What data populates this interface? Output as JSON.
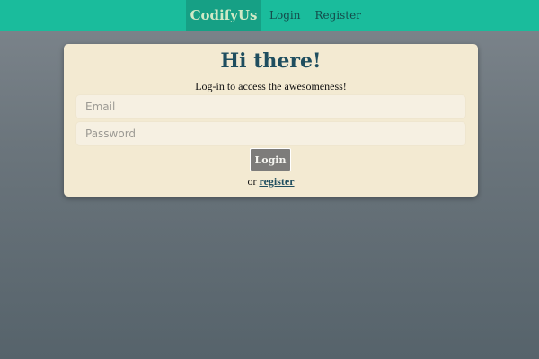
{
  "navbar": {
    "brand": "CodifyUs",
    "links": [
      "Login",
      "Register"
    ]
  },
  "login_card": {
    "title": "Hi there!",
    "subtitle": "Log-in to access the awesomeness!",
    "email_placeholder": "Email",
    "password_placeholder": "Password",
    "login_button": "Login",
    "register_prefix": "or",
    "register_link": "register"
  },
  "colors": {
    "navbar": "#1abc9c",
    "brand_background": "#16a085",
    "card_background": "#f3ead2",
    "title": "#1f4e5f",
    "button": "#7d7c7a"
  }
}
